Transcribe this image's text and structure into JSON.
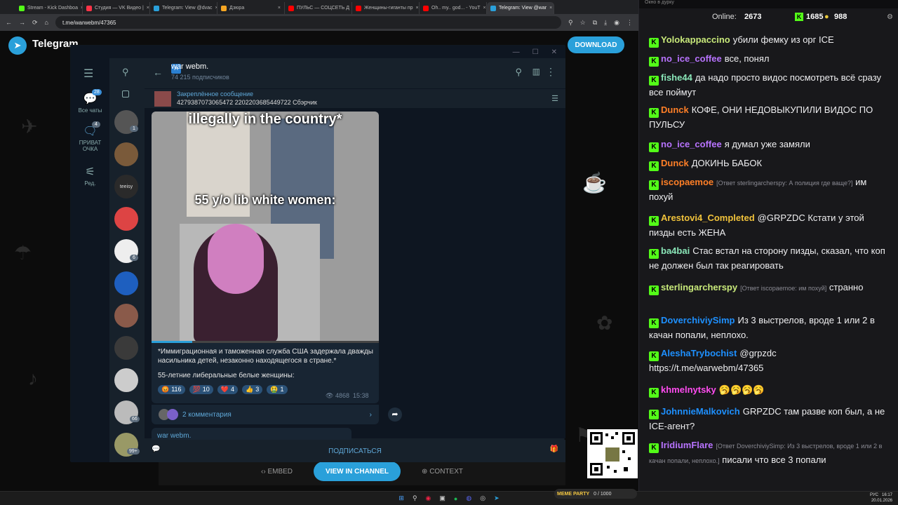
{
  "browser": {
    "tabs": [
      {
        "label": "Stream - Kick Dashboa",
        "color": "#53fc18"
      },
      {
        "label": "Студия — VK Видео |",
        "color": "#ff3347"
      },
      {
        "label": "Telegram: View @dvac",
        "color": "#2aa0da"
      },
      {
        "label": "Дзюра",
        "color": "#f5a623"
      },
      {
        "label": "ПУЛЬС — СОЦСЕТЬ Д",
        "color": "#ff0000"
      },
      {
        "label": "Женщины-гиганты пр",
        "color": "#ff0000"
      },
      {
        "label": "Oh.. my.. god... - YouT",
        "color": "#ff0000"
      },
      {
        "label": "Telegram: View @war",
        "color": "#2aa0da"
      }
    ],
    "url": "t.me/warwebm/47365"
  },
  "tgpage": {
    "brand": "Telegram",
    "download": "DOWNLOAD",
    "embed": "EMBED",
    "view_in_channel": "VIEW IN CHANNEL",
    "context": "CONTEXT"
  },
  "tgapp": {
    "menu": [
      {
        "label": "Все чаты",
        "badge": "28"
      },
      {
        "label": "ПРИВАТ ОЧКА",
        "badge": "4"
      },
      {
        "label": "Ред.",
        "badge": ""
      }
    ],
    "chat_badges": [
      "1",
      "6",
      "66",
      "99+"
    ],
    "avatar_text": "teeisy",
    "channel_name": "war webm.",
    "subscribers": "74 215 подписчиков",
    "pinned_title": "Закреплённое сообщение",
    "pinned_text": "4279387073065472 2202203685449722 Сбэрчик",
    "meme_top": "illegally in the country*",
    "meme_mid": "55 y/o lib white women:",
    "caption1": "*Иммиграционная и таможенная служба США задержала дважды насильника детей, незаконно находящегося в стране.*",
    "caption2": "55-летние либеральные белые женщины:",
    "reactions": [
      {
        "emoji": "😡",
        "count": "116"
      },
      {
        "emoji": "💯",
        "count": "10"
      },
      {
        "emoji": "❤️",
        "count": "4"
      },
      {
        "emoji": "👍",
        "count": "3"
      },
      {
        "emoji": "🤮",
        "count": "1"
      }
    ],
    "views": "4868",
    "time": "15:38",
    "comments": "2 комментария",
    "next_msg": "war webm.",
    "subscribe": "ПОДПИСАТЬСЯ"
  },
  "chat": {
    "window_title": "Окно в дурку",
    "online_label": "Online:",
    "online": "2673",
    "kick_count": "1685",
    "other_count": "988",
    "messages": [
      {
        "user": "Yolokappaccino",
        "color": "#c8e97a",
        "text": "убили фемку из орг ICE",
        "reply": ""
      },
      {
        "user": "no_ice_coffee",
        "color": "#b873ff",
        "text": "все, понял",
        "reply": ""
      },
      {
        "user": "fishe44",
        "color": "#8ae6b8",
        "text": "да надо просто видос посмотреть всё сразу все поймут",
        "reply": ""
      },
      {
        "user": "Dunck",
        "color": "#ff7f27",
        "text": "КОФЕ, ОНИ НЕДОВЫКУПИЛИ ВИДОС ПО ПУЛЬСУ",
        "reply": ""
      },
      {
        "user": "no_ice_coffee",
        "color": "#b873ff",
        "text": "я думал уже замяли",
        "reply": ""
      },
      {
        "user": "Dunck",
        "color": "#ff7f27",
        "text": "ДОКИНЬ БАБОК",
        "reply": ""
      },
      {
        "user": "iscopaemoe",
        "color": "#ff7f27",
        "text": "им похуй",
        "reply": "[Ответ sterlingarcherspy: А полиция где ваще?]"
      },
      {
        "user": "Arestovi4_Completed",
        "color": "#f0c23b",
        "text": "@GRPZDC Кстати у этой пизды есть ЖЕНА",
        "reply": ""
      },
      {
        "user": "ba4bai",
        "color": "#8ae6b8",
        "text": "Стас встал на сторону пизды, сказал, что коп не должен был так реагировать",
        "reply": ""
      },
      {
        "user": "sterlingarcherspy",
        "color": "#c8e97a",
        "text": "странно",
        "reply": "[Ответ iscopaemoe: им похуй]"
      },
      {
        "user": "DoverchiviySimp",
        "color": "#1e90ff",
        "text": "Из 3 выстрелов, вроде 1 или 2 в качан попали, неплохо.",
        "reply": ""
      },
      {
        "user": "AleshaTrybochist",
        "color": "#1e90ff",
        "text": "@grpzdc https://t.me/warwebm/47365",
        "reply": ""
      },
      {
        "user": "khmelnytsky",
        "color": "#ff4cf0",
        "text": "🥱🥱🥱🥱",
        "reply": ""
      },
      {
        "user": "JohnnieMalkovich",
        "color": "#1e90ff",
        "text": "GRPZDC там разве коп был, а не ICE-агент?",
        "reply": ""
      },
      {
        "user": "IridiumFlare",
        "color": "#b873ff",
        "text": "писали что все 3 попали",
        "reply": "[Ответ DoverchiviySimp: Из 3 выстрелов, вроде 1 или 2 в качан попали, неплохо.]"
      }
    ]
  },
  "taskbar": {
    "meme_party": "MEME PARTY",
    "counter": "0 / 1000",
    "lang": "РУС",
    "time": "16:17",
    "date": "20.01.2026"
  }
}
